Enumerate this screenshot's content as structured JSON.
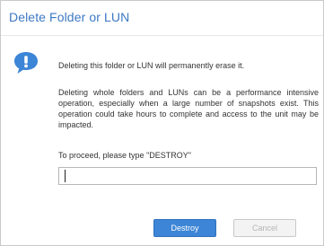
{
  "dialog": {
    "title": "Delete Folder or LUN",
    "icon": "info-icon",
    "message_primary": "Deleting this folder or LUN will permanently erase it.",
    "message_secondary": "Deleting whole folders and LUNs can be a performance intensive operation, especially when a large number of snapshots exist. This operation could take hours to complete and access to the unit may be impacted.",
    "confirm_prompt": "To proceed, please type \"DESTROY\"",
    "confirm_input_value": "",
    "destroy_label": "Destroy",
    "cancel_label": "Cancel"
  },
  "colors": {
    "title": "#3c78c3",
    "icon": "#3d85d6",
    "destroy_button": "#3d85d6",
    "cancel_button": "#f3f3f3"
  }
}
